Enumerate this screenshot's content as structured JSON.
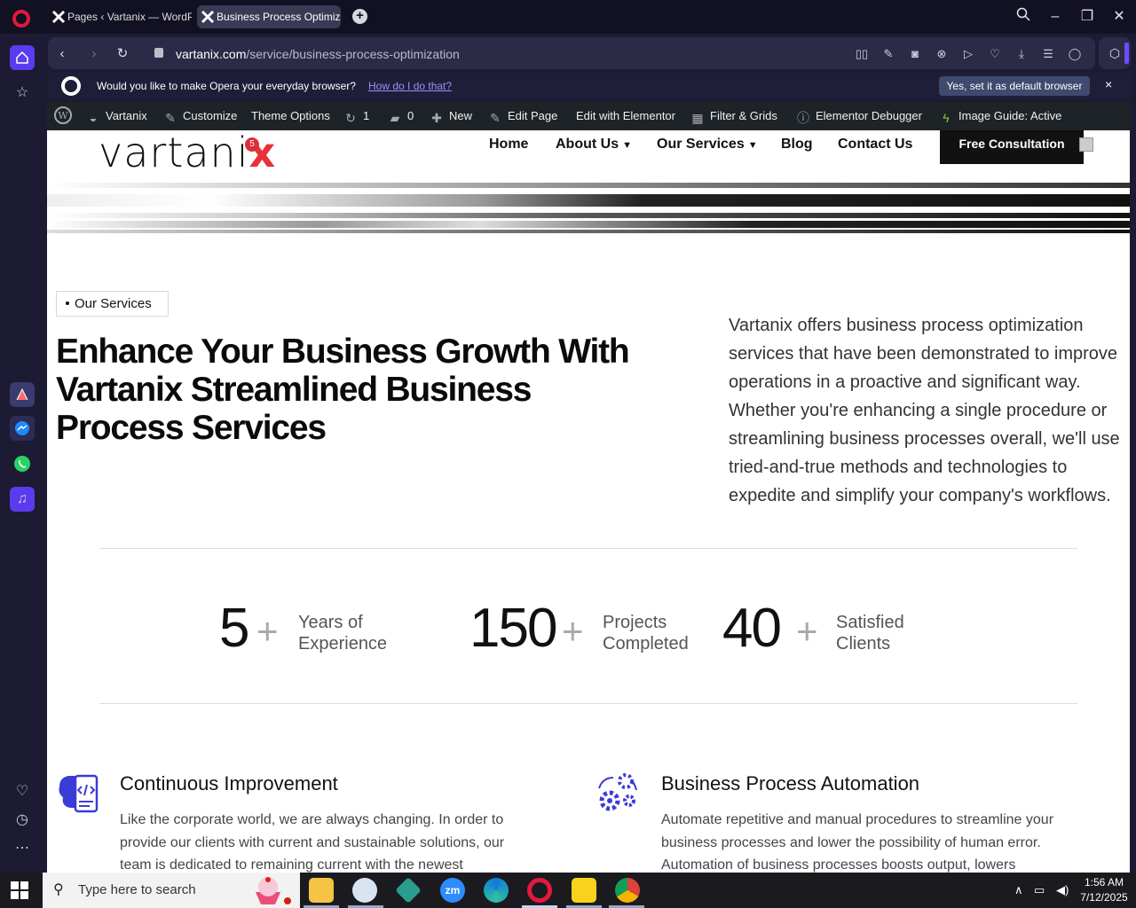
{
  "browser": {
    "tabs": [
      {
        "label": "Pages ‹ Vartanix — WordP",
        "active": false
      },
      {
        "label": "Business Process Optimiza",
        "active": true
      }
    ],
    "url_host": "vartanix.com",
    "url_path": "/service/business-process-optimization",
    "prompt": {
      "text": "Would you like to make Opera your everyday browser?",
      "link": "How do I do that?",
      "button": "Yes, set it as default browser",
      "close": "×"
    }
  },
  "wp_admin": {
    "site": "Vartanix",
    "customize": "Customize",
    "theme_options": "Theme Options",
    "updates": "1",
    "comments": "0",
    "new": "New",
    "edit_page": "Edit Page",
    "edit_elementor": "Edit with Elementor",
    "filter_grids": "Filter & Grids",
    "debugger": "Elementor Debugger",
    "image_guide": "Image Guide: Active"
  },
  "site": {
    "logo": {
      "text": "vartani",
      "x": "x",
      "badge": "5"
    },
    "nav": [
      {
        "label": "Home",
        "dropdown": false
      },
      {
        "label": "About Us",
        "dropdown": true
      },
      {
        "label": "Our Services",
        "dropdown": true
      },
      {
        "label": "Blog",
        "dropdown": false
      },
      {
        "label": "Contact Us",
        "dropdown": false
      }
    ],
    "cta": "Free Consultation"
  },
  "hero": {
    "tag": "Our Services",
    "headline": "Enhance Your Business Growth With Vartanix Streamlined Business Process Services",
    "intro": "Vartanix offers business process optimization services that have been demonstrated to improve operations in a proactive and significant way. Whether you're enhancing a single procedure or streamlining business processes overall, we'll use tried-and-true methods and technologies to expedite and simplify your company's workflows."
  },
  "stats": [
    {
      "number": "5",
      "plus": "+",
      "label_1": "Years of",
      "label_2": "Experience"
    },
    {
      "number": "150",
      "plus": "+",
      "label_1": "Projects",
      "label_2": "Completed"
    },
    {
      "number": "40",
      "plus": "+",
      "label_1": "Satisfied",
      "label_2": "Clients"
    }
  ],
  "features": [
    {
      "title": "Continuous Improvement",
      "text": "Like the corporate world, we are always changing. In order to provide our clients with current and sustainable solutions, our team is dedicated to remaining current with the newest"
    },
    {
      "title": "Business Process Automation",
      "text": "Automate repetitive and manual procedures to streamline your business processes and lower the possibility of human error. Automation of business processes boosts output, lowers"
    }
  ],
  "taskbar": {
    "search_placeholder": "Type here to search",
    "time": "1:56 AM",
    "date": "7/12/2025"
  },
  "colors": {
    "opera_red": "#e3183d",
    "sidebar_accent": "#5b3bf0",
    "wp_bar": "#1d2327",
    "feature_icon": "#3b3bd8",
    "brand_red": "#e8313a"
  }
}
